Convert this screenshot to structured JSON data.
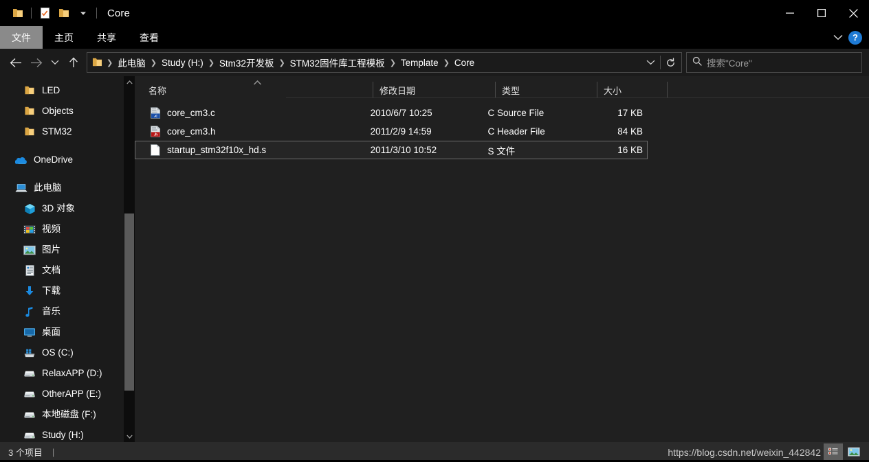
{
  "window": {
    "title": "Core",
    "quick_access": [
      {
        "name": "folder-icon",
        "label": "文件夹"
      },
      {
        "name": "properties-icon",
        "label": "属性"
      },
      {
        "name": "new-folder-icon",
        "label": "新建文件夹"
      },
      {
        "name": "chevron-down-icon",
        "label": "自定义快速访问工具栏"
      }
    ],
    "controls": {
      "minimize": "最小化",
      "maximize": "最大化",
      "close": "关闭"
    }
  },
  "ribbon": {
    "tabs": [
      {
        "label": "文件",
        "active": true
      },
      {
        "label": "主页",
        "active": false
      },
      {
        "label": "共享",
        "active": false
      },
      {
        "label": "查看",
        "active": false
      }
    ],
    "expand_label": "展开功能区",
    "help_label": "?"
  },
  "addressbar": {
    "back_label": "后退",
    "forward_label": "前进",
    "recent_label": "最近浏览过的位置",
    "up_label": "上移到",
    "breadcrumbs": [
      "此电脑",
      "Study (H:)",
      "Stm32开发板",
      "STM32固件库工程模板",
      "Template",
      "Core"
    ],
    "dropdown_label": "展开",
    "refresh_label": "刷新",
    "search_placeholder": "搜索\"Core\""
  },
  "navpane": {
    "items": [
      {
        "label": "LED",
        "icon": "folder-icon",
        "level": "child"
      },
      {
        "label": "Objects",
        "icon": "folder-icon",
        "level": "child"
      },
      {
        "label": "STM32",
        "icon": "folder-icon",
        "level": "child"
      },
      {
        "gap": true
      },
      {
        "label": "OneDrive",
        "icon": "onedrive-icon",
        "level": "root"
      },
      {
        "gap": true
      },
      {
        "label": "此电脑",
        "icon": "this-pc-icon",
        "level": "root"
      },
      {
        "label": "3D 对象",
        "icon": "3d-objects-icon",
        "level": "child"
      },
      {
        "label": "视频",
        "icon": "videos-icon",
        "level": "child"
      },
      {
        "label": "图片",
        "icon": "pictures-icon",
        "level": "child"
      },
      {
        "label": "文档",
        "icon": "documents-icon",
        "level": "child"
      },
      {
        "label": "下载",
        "icon": "downloads-icon",
        "level": "child"
      },
      {
        "label": "音乐",
        "icon": "music-icon",
        "level": "child"
      },
      {
        "label": "桌面",
        "icon": "desktop-icon",
        "level": "child"
      },
      {
        "label": "OS (C:)",
        "icon": "os-drive-icon",
        "level": "child"
      },
      {
        "label": "RelaxAPP (D:)",
        "icon": "drive-icon",
        "level": "child"
      },
      {
        "label": "OtherAPP (E:)",
        "icon": "drive-icon",
        "level": "child"
      },
      {
        "label": "本地磁盘 (F:)",
        "icon": "drive-icon",
        "level": "child"
      },
      {
        "label": "Study (H:)",
        "icon": "drive-icon",
        "level": "child"
      }
    ]
  },
  "filelist": {
    "columns": [
      {
        "label": "名称",
        "key": "name"
      },
      {
        "label": "修改日期",
        "key": "date"
      },
      {
        "label": "类型",
        "key": "type"
      },
      {
        "label": "大小",
        "key": "size"
      }
    ],
    "sort": {
      "column": "名称",
      "direction": "asc"
    },
    "rows": [
      {
        "icon": "c-source-file-icon",
        "name": "core_cm3.c",
        "date": "2010/6/7 10:25",
        "type": "C Source File",
        "size": "17 KB",
        "selected": false
      },
      {
        "icon": "c-header-file-icon",
        "name": "core_cm3.h",
        "date": "2011/2/9 14:59",
        "type": "C Header File",
        "size": "84 KB",
        "selected": false
      },
      {
        "icon": "generic-file-icon",
        "name": "startup_stm32f10x_hd.s",
        "date": "2011/3/10 10:52",
        "type": "S 文件",
        "size": "16 KB",
        "selected": true
      }
    ]
  },
  "statusbar": {
    "item_count": "3 个项目",
    "separator": "|",
    "views": [
      {
        "name": "details-view-button",
        "label": "详细信息",
        "active": true
      },
      {
        "name": "large-icons-view-button",
        "label": "大图标",
        "active": false
      }
    ]
  },
  "watermark": {
    "text": "https://blog.csdn.net/weixin_442842"
  },
  "colors": {
    "titlebar_bg": "#000000",
    "window_bg": "#1b1b1b",
    "filepane_bg": "#202020",
    "statusbar_bg": "#2b2b2b",
    "accent": "#1e7ad4",
    "text": "#ffffff",
    "muted_text": "#9a9a9a",
    "selected_row_bg": "#252525",
    "selected_row_border": "#6e6e6e",
    "folder_yellow": "#f6c863"
  }
}
